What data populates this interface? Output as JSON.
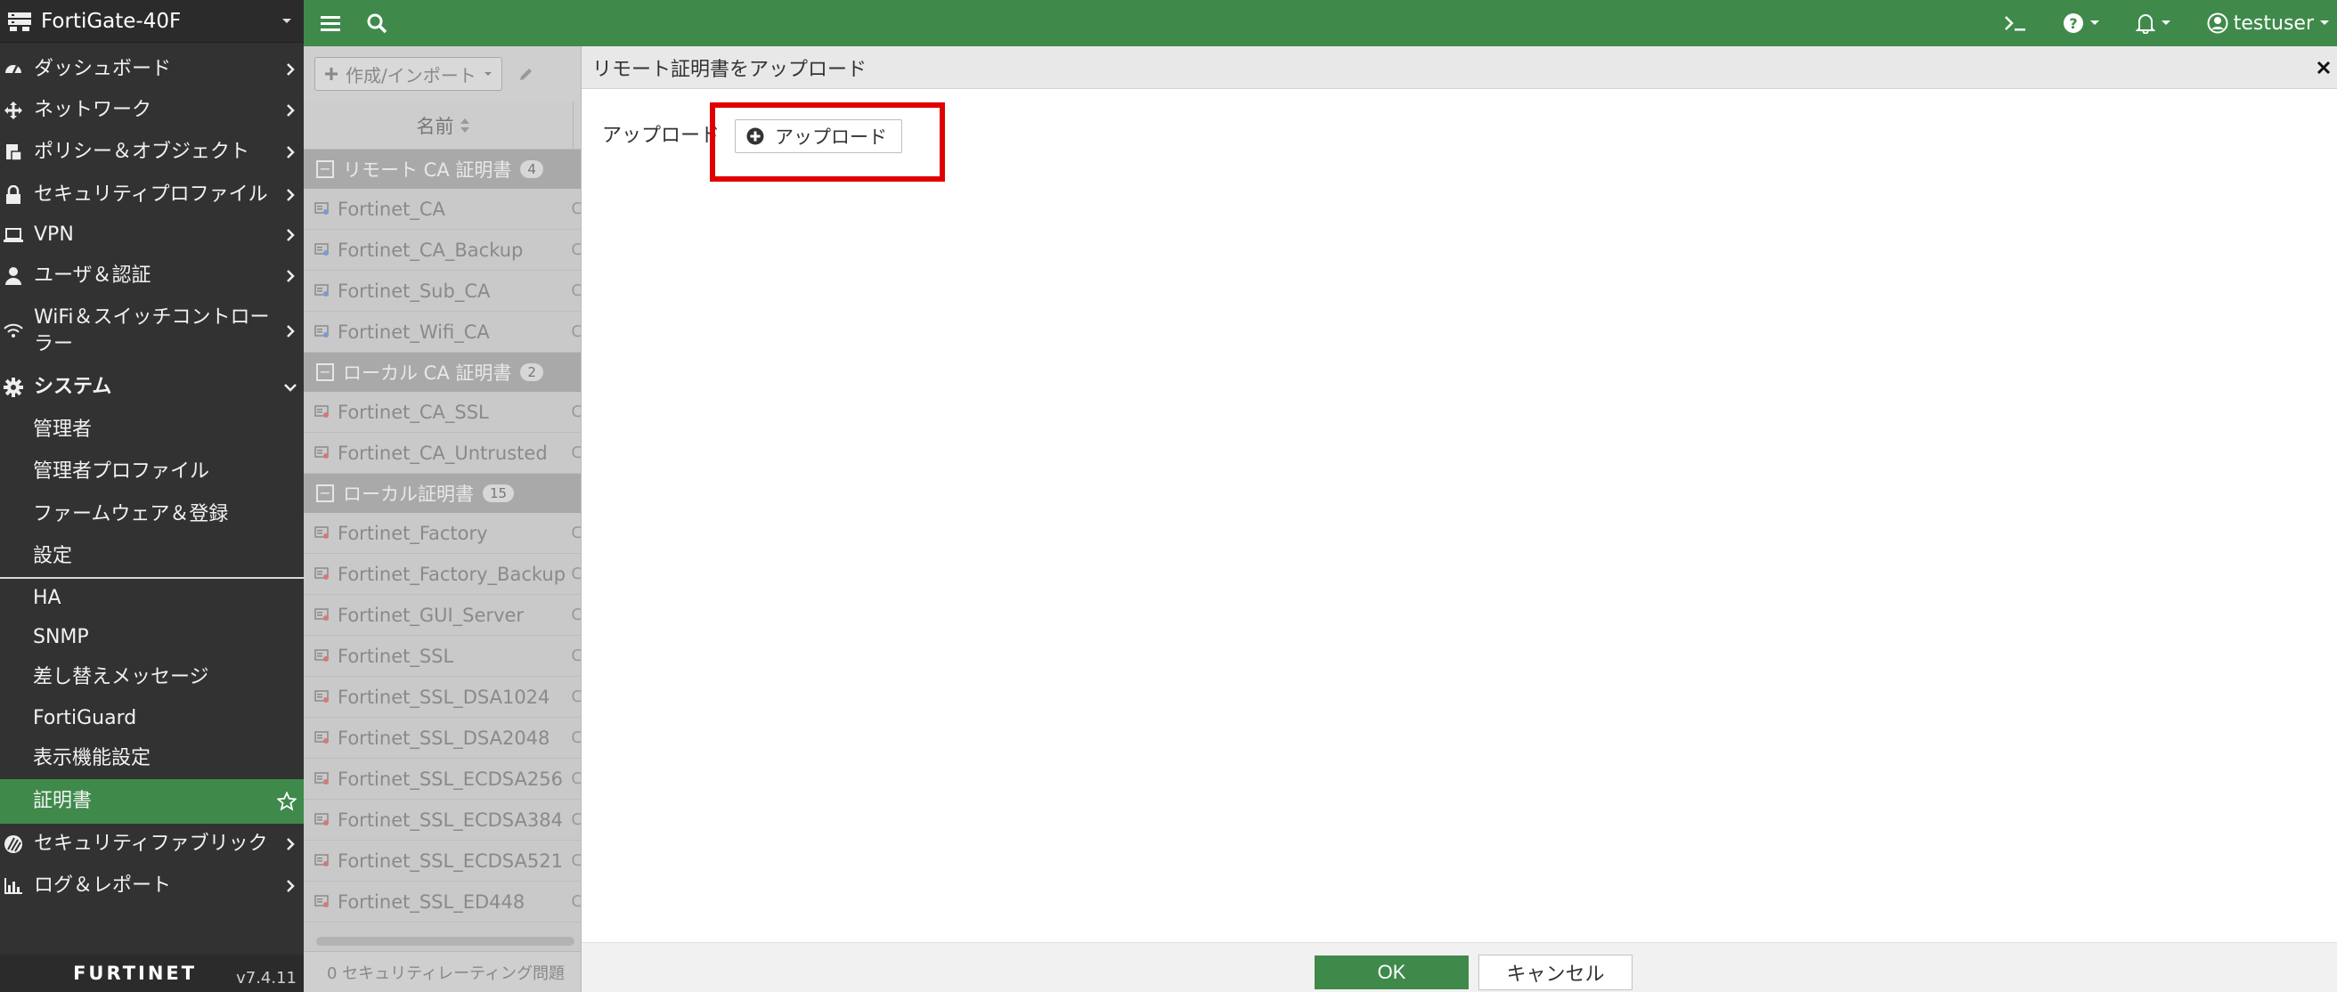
{
  "header": {
    "device_name": "FortiGate-40F",
    "user": "testuser"
  },
  "sidebar": {
    "items": [
      {
        "label": "ダッシュボード"
      },
      {
        "label": "ネットワーク"
      },
      {
        "label": "ポリシー＆オブジェクト"
      },
      {
        "label": "セキュリティプロファイル"
      },
      {
        "label": "VPN"
      },
      {
        "label": "ユーザ＆認証"
      },
      {
        "label": "WiFi＆スイッチコントローラー"
      },
      {
        "label": "システム"
      },
      {
        "label": "管理者"
      },
      {
        "label": "管理者プロファイル"
      },
      {
        "label": "ファームウェア＆登録"
      },
      {
        "label": "設定"
      },
      {
        "label": "HA"
      },
      {
        "label": "SNMP"
      },
      {
        "label": "差し替えメッセージ"
      },
      {
        "label": "FortiGuard"
      },
      {
        "label": "表示機能設定"
      },
      {
        "label": "証明書"
      },
      {
        "label": "セキュリティファブリック"
      },
      {
        "label": "ログ＆レポート"
      }
    ],
    "footer_logo": "FURTINET",
    "version": "v7.4.11"
  },
  "list": {
    "create_label": "作成/インポート",
    "column_name": "名前",
    "groups": [
      {
        "label": "リモート CA 証明書",
        "count": "4",
        "rows": [
          "Fortinet_CA",
          "Fortinet_CA_Backup",
          "Fortinet_Sub_CA",
          "Fortinet_Wifi_CA"
        ]
      },
      {
        "label": "ローカル CA 証明書",
        "count": "2",
        "rows": [
          "Fortinet_CA_SSL",
          "Fortinet_CA_Untrusted"
        ]
      },
      {
        "label": "ローカル証明書",
        "count": "15",
        "rows": [
          "Fortinet_Factory",
          "Fortinet_Factory_Backup",
          "Fortinet_GUI_Server",
          "Fortinet_SSL",
          "Fortinet_SSL_DSA1024",
          "Fortinet_SSL_DSA2048",
          "Fortinet_SSL_ECDSA256",
          "Fortinet_SSL_ECDSA384",
          "Fortinet_SSL_ECDSA521",
          "Fortinet_SSL_ED448"
        ]
      }
    ],
    "status_text": "0  セキュリティレーティング問題"
  },
  "dialog": {
    "title": "リモート証明書をアップロード",
    "field_label": "アップロード",
    "upload_button": "アップロード",
    "ok": "OK",
    "cancel": "キャンセル"
  },
  "colors": {
    "accent": "#3f8a4b",
    "highlight": "#e00000",
    "sidebar_bg": "#323232"
  }
}
